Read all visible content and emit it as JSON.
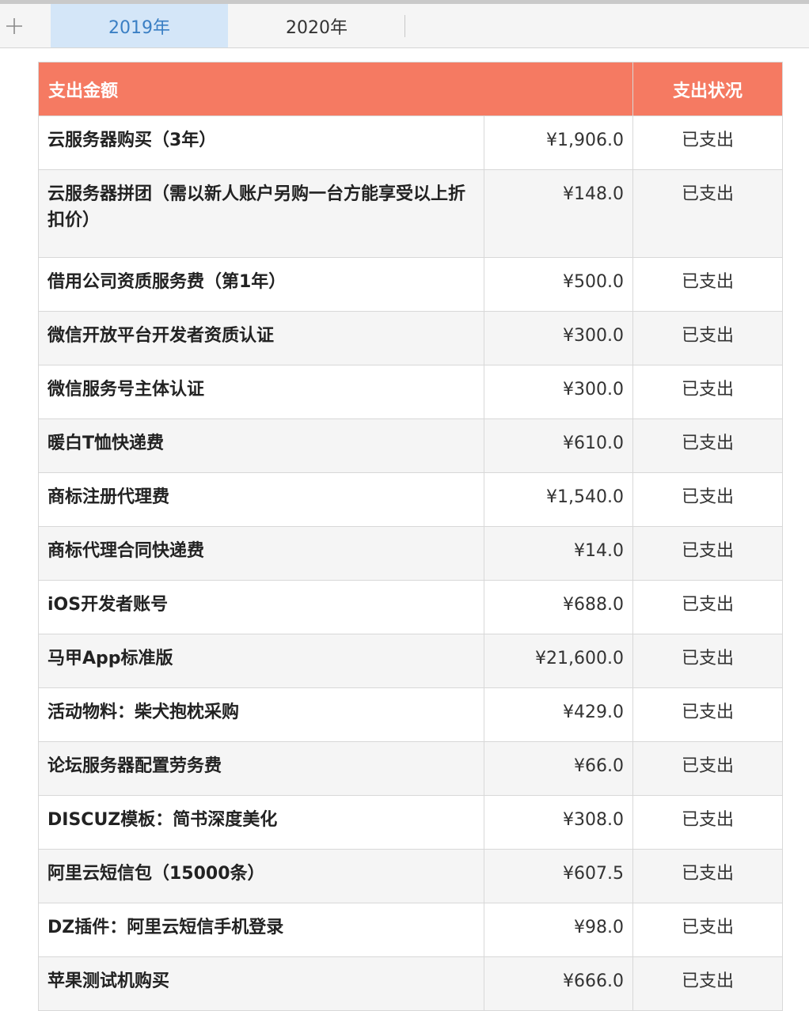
{
  "tabs": [
    {
      "label": "2019年",
      "active": true
    },
    {
      "label": "2020年",
      "active": false
    }
  ],
  "add_tab_icon": "plus-icon",
  "colors": {
    "header_bg": "#f57a62",
    "header_text": "#ffffff",
    "active_tab_bg": "#d4e6f8",
    "active_tab_text": "#3a7fc4"
  },
  "table": {
    "headers": {
      "amount": "支出金额",
      "status": "支出状况"
    },
    "rows": [
      {
        "name": "云服务器购买（3年）",
        "amount": "¥1,906.0",
        "status": "已支出"
      },
      {
        "name": "云服务器拼团（需以新人账户另购一台方能享受以上折扣价）",
        "amount": "¥148.0",
        "status": "已支出"
      },
      {
        "name": "借用公司资质服务费（第1年）",
        "amount": "¥500.0",
        "status": "已支出"
      },
      {
        "name": "微信开放平台开发者资质认证",
        "amount": "¥300.0",
        "status": "已支出"
      },
      {
        "name": "微信服务号主体认证",
        "amount": "¥300.0",
        "status": "已支出"
      },
      {
        "name": "暖白T恤快递费",
        "amount": "¥610.0",
        "status": "已支出"
      },
      {
        "name": "商标注册代理费",
        "amount": "¥1,540.0",
        "status": "已支出"
      },
      {
        "name": "商标代理合同快递费",
        "amount": "¥14.0",
        "status": "已支出"
      },
      {
        "name": "iOS开发者账号",
        "amount": "¥688.0",
        "status": "已支出"
      },
      {
        "name": "马甲App标准版",
        "amount": "¥21,600.0",
        "status": "已支出"
      },
      {
        "name": "活动物料：柴犬抱枕采购",
        "amount": "¥429.0",
        "status": "已支出"
      },
      {
        "name": "论坛服务器配置劳务费",
        "amount": "¥66.0",
        "status": "已支出"
      },
      {
        "name": "DISCUZ模板：简书深度美化",
        "amount": "¥308.0",
        "status": "已支出"
      },
      {
        "name": "阿里云短信包（15000条）",
        "amount": "¥607.5",
        "status": "已支出"
      },
      {
        "name": "DZ插件：阿里云短信手机登录",
        "amount": "¥98.0",
        "status": "已支出"
      },
      {
        "name": "苹果测试机购买",
        "amount": "¥666.0",
        "status": "已支出"
      }
    ]
  }
}
